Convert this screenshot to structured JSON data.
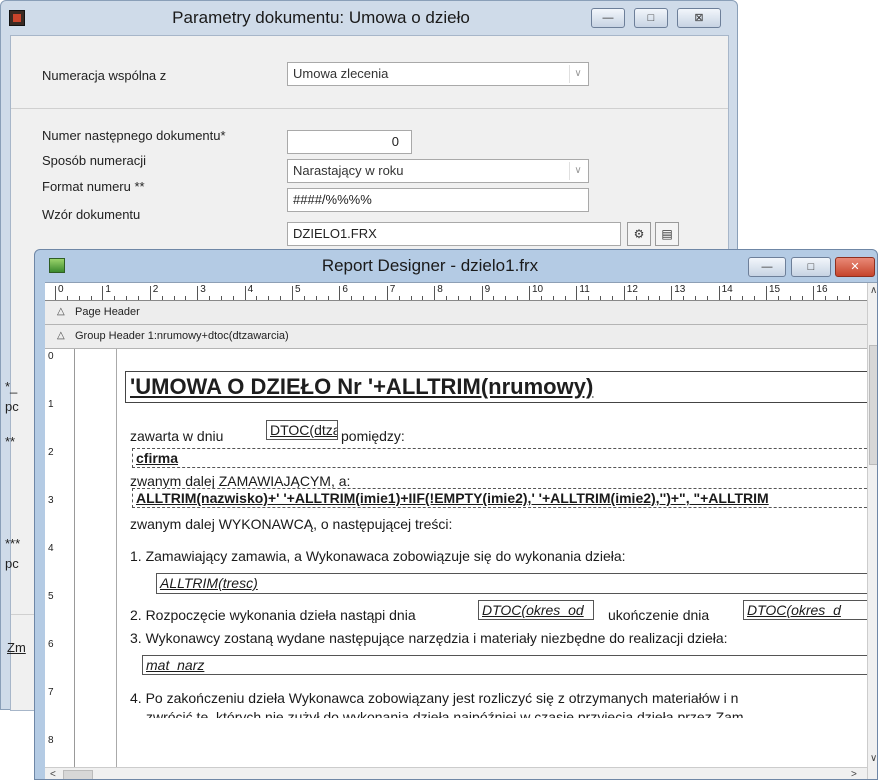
{
  "params_window": {
    "title": "Parametry dokumentu: Umowa o dzieło",
    "minimize_glyph": "—",
    "maximize_glyph": "□",
    "close_glyph": "⊠",
    "numeracja_label": "Numeracja wspólna z",
    "numeracja_value": "Umowa zlecenia",
    "numer_label": "Numer następnego dokumentu*",
    "numer_value": "0",
    "sposob_label": "Sposób numeracji",
    "sposob_value": "Narastający w roku",
    "format_label": "Format numeru **",
    "format_value": "####/%%%%",
    "wzor_label": "Wzór dokumentu",
    "wzor_value": "DZIELO1.FRX",
    "partial_text_1": "*_",
    "partial_text_2": "pc",
    "partial_text_3": "**",
    "partial_text_4": "***",
    "partial_text_5": "pc",
    "partial_button": "Zm"
  },
  "designer_window": {
    "title": "Report Designer - dzielo1.frx",
    "minimize_glyph": "—",
    "maximize_glyph": "□",
    "close_glyph": "✕",
    "ruler_numbers": [
      "0",
      "1",
      "2",
      "3",
      "4",
      "5",
      "6",
      "7",
      "8",
      "9",
      "10",
      "11",
      "12",
      "13",
      "14",
      "15",
      "16"
    ],
    "vruler_numbers": [
      "0",
      "1",
      "2",
      "3",
      "4",
      "5",
      "6",
      "7",
      "8"
    ],
    "band_page_header": "Page Header",
    "band_group_header": "Group Header 1:nrumowy+dtoc(dtzawarcia)",
    "report": {
      "title_expr": "'UMOWA O DZIEŁO Nr '+ALLTRIM(nrumowy)",
      "zawarta_w_dniu": "zawarta w dniu",
      "dtzaw_expr": "DTOC(dtzaw",
      "pomiedzy": "pomiędzy:",
      "cfirma": "cfirma",
      "zwanym_zam": "zwanym dalej ZAMAWIAJĄCYM, a:",
      "nazwisko_expr": "ALLTRIM(nazwisko)+' '+ALLTRIM(imie1)+IIF(!EMPTY(imie2),' '+ALLTRIM(imie2),'')+\", \"+ALLTRIM",
      "zwanym_wyk": "zwanym dalej WYKONAWCĄ, o następującej treści:",
      "pkt1": "1. Zamawiający zamawia, a Wykonawaca zobowiązuje się do wykonania dzieła:",
      "tresc_expr": "ALLTRIM(tresc)",
      "pkt2": "2. Rozpoczęcie wykonania dzieła nastąpi dnia",
      "okres_od_expr": "DTOC(okres_od",
      "ukonczenie": "ukończenie dnia",
      "okres_do_expr": "DTOC(okres_d",
      "pkt3": "3. Wykonawcy zostaną wydane następujące narzędzia i materiały niezbędne do realizacji dzieła:",
      "mat_narz_expr": "mat_narz",
      "pkt4": "4. Po zakończeniu dzieła Wykonawca zobowiązany jest rozliczyć się z otrzymanych materiałów i n",
      "pkt4_cont": "zwrócić te, których nie zużył do wykonania dzieła najpóźniej w czasie przyjęcia dzieła przez Zam"
    }
  }
}
